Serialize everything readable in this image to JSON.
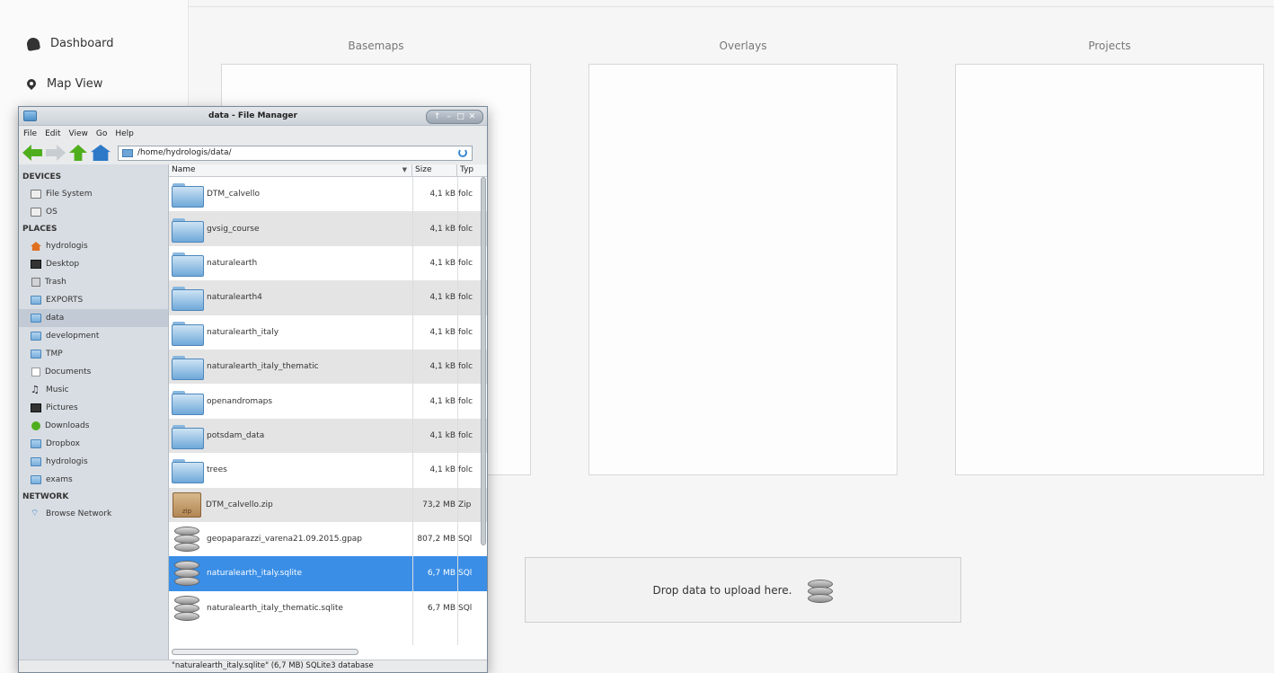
{
  "nav": {
    "items": [
      {
        "label": "Dashboard",
        "icon": "dashboard-icon"
      },
      {
        "label": "Map View",
        "icon": "map-marker-icon"
      }
    ]
  },
  "columns": [
    {
      "title": "Basemaps"
    },
    {
      "title": "Overlays"
    },
    {
      "title": "Projects"
    }
  ],
  "drop_zone": {
    "text": "Drop data to upload here.",
    "icon": "database-upload-icon"
  },
  "file_manager": {
    "title": "data - File Manager",
    "window_buttons": [
      "↑",
      "–",
      "□",
      "✕"
    ],
    "menu": [
      "File",
      "Edit",
      "View",
      "Go",
      "Help"
    ],
    "path": "/home/hydrologis/data/",
    "sections": {
      "devices": "DEVICES",
      "places": "PLACES",
      "network": "NETWORK"
    },
    "devices": [
      {
        "label": "File System",
        "icon": "drive-icon"
      },
      {
        "label": "OS",
        "icon": "drive-icon"
      }
    ],
    "places": [
      {
        "label": "hydrologis",
        "icon": "home-icon"
      },
      {
        "label": "Desktop",
        "icon": "desktop-icon"
      },
      {
        "label": "Trash",
        "icon": "trash-icon"
      },
      {
        "label": "EXPORTS",
        "icon": "folder-icon"
      },
      {
        "label": "data",
        "icon": "folder-icon",
        "selected": true
      },
      {
        "label": "development",
        "icon": "folder-icon"
      },
      {
        "label": "TMP",
        "icon": "folder-icon"
      },
      {
        "label": "Documents",
        "icon": "document-icon"
      },
      {
        "label": "Music",
        "icon": "music-icon"
      },
      {
        "label": "Pictures",
        "icon": "pictures-icon"
      },
      {
        "label": "Downloads",
        "icon": "download-icon"
      },
      {
        "label": "Dropbox",
        "icon": "folder-icon"
      },
      {
        "label": "hydrologis",
        "icon": "folder-icon"
      },
      {
        "label": "exams",
        "icon": "folder-icon"
      }
    ],
    "network": [
      {
        "label": "Browse Network",
        "icon": "wifi-icon"
      }
    ],
    "headers": {
      "name": "Name",
      "size": "Size",
      "type": "Typ"
    },
    "files": [
      {
        "name": "DTM_calvello",
        "size": "4,1 kB",
        "type": "folc",
        "kind": "folder"
      },
      {
        "name": "gvsig_course",
        "size": "4,1 kB",
        "type": "folc",
        "kind": "folder"
      },
      {
        "name": "naturalearth",
        "size": "4,1 kB",
        "type": "folc",
        "kind": "folder"
      },
      {
        "name": "naturalearth4",
        "size": "4,1 kB",
        "type": "folc",
        "kind": "folder"
      },
      {
        "name": "naturalearth_italy",
        "size": "4,1 kB",
        "type": "folc",
        "kind": "folder"
      },
      {
        "name": "naturalearth_italy_thematic",
        "size": "4,1 kB",
        "type": "folc",
        "kind": "folder"
      },
      {
        "name": "openandromaps",
        "size": "4,1 kB",
        "type": "folc",
        "kind": "folder"
      },
      {
        "name": "potsdam_data",
        "size": "4,1 kB",
        "type": "folc",
        "kind": "folder"
      },
      {
        "name": "trees",
        "size": "4,1 kB",
        "type": "folc",
        "kind": "folder"
      },
      {
        "name": "DTM_calvello.zip",
        "size": "73,2 MB",
        "type": "Zip",
        "kind": "zip"
      },
      {
        "name": "geopaparazzi_varena21.09.2015.gpap",
        "size": "807,2 MB",
        "type": "SQl",
        "kind": "sqlite"
      },
      {
        "name": "naturalearth_italy.sqlite",
        "size": "6,7 MB",
        "type": "SQl",
        "kind": "sqlite",
        "selected": true
      },
      {
        "name": "naturalearth_italy_thematic.sqlite",
        "size": "6,7 MB",
        "type": "SQl",
        "kind": "sqlite"
      }
    ],
    "zip_label": "zip",
    "status": "\"naturalearth_italy.sqlite\" (6,7 MB) SQLite3 database"
  }
}
